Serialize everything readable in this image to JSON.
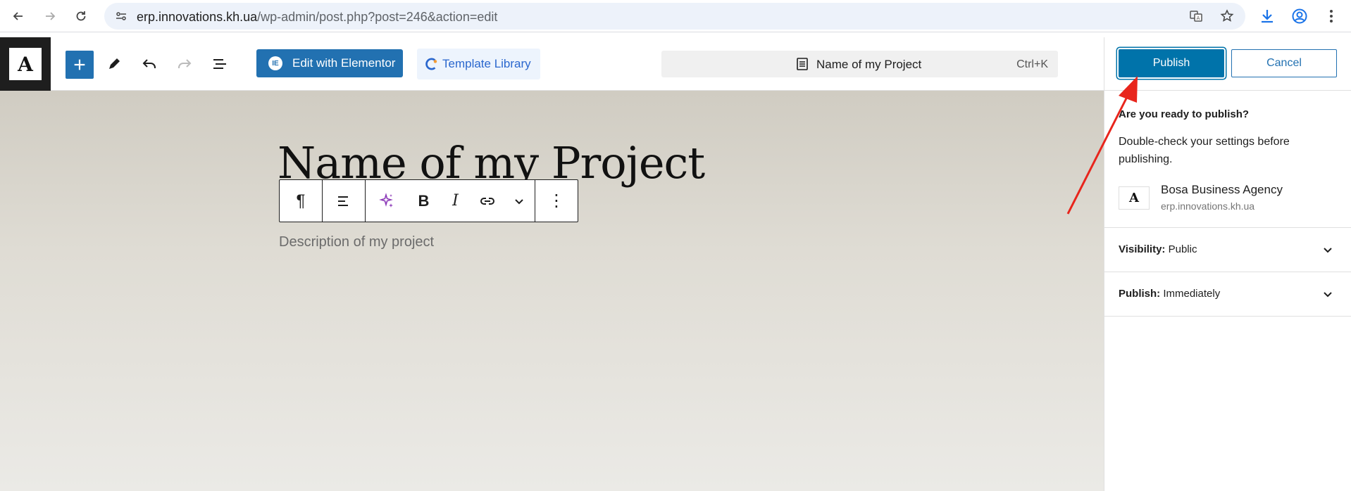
{
  "browser": {
    "url_domain": "erp.innovations.kh.ua",
    "url_path": "/wp-admin/post.php?post=246&action=edit"
  },
  "header": {
    "logo_text": "A",
    "elementor_label": "Edit with Elementor",
    "elementor_icon_text": "IE",
    "template_label": "Template Library",
    "document_title": "Name of my Project",
    "document_shortcut": "Ctrl+K"
  },
  "canvas": {
    "title": "Name of my Project",
    "description": "Description of my project"
  },
  "toolbar": {
    "paragraph_glyph": "¶",
    "bold_glyph": "B",
    "italic_glyph": "I",
    "more_glyph": "⋮"
  },
  "panel": {
    "publish_label": "Publish",
    "cancel_label": "Cancel",
    "ready_question": "Are you ready to publish?",
    "ready_text": "Double-check your settings before publishing.",
    "site_icon_text": "A",
    "site_name": "Bosa Business Agency",
    "site_url": "erp.innovations.kh.ua",
    "visibility_label": "Visibility:",
    "visibility_value": "Public",
    "publish_time_label": "Publish:",
    "publish_time_value": "Immediately"
  },
  "colors": {
    "accent": "#2271b1",
    "publish": "#0073aa",
    "template": "#2a67ce",
    "annotation": "#e8251c"
  }
}
